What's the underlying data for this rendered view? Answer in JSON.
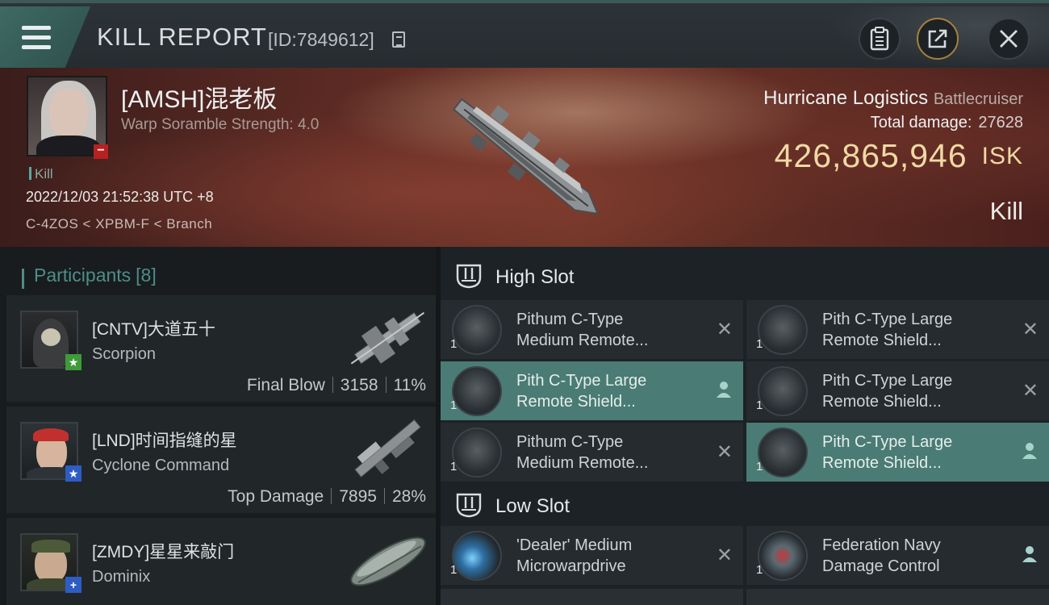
{
  "header": {
    "title": "KILL REPORT",
    "kill_id": "[ID:7849612]"
  },
  "victim": {
    "name": "[AMSH]混老板",
    "warp": "Warp Soramble Strength: 4.0",
    "tag": "Kill",
    "datetime": "2022/12/03 21:52:38 UTC +8",
    "location": "C-4ZOS < XPBM-F < Branch",
    "ship": "Hurricane Logistics",
    "ship_class": "Battlecruiser",
    "total_damage_label": "Total damage:",
    "total_damage": "27628",
    "isk_value": "426,865,946",
    "isk_unit": "ISK",
    "result": "Kill"
  },
  "participants": {
    "label": "Participants",
    "count": "[8]",
    "items": [
      {
        "name": "[CNTV]大道五十",
        "ship": "Scorpion",
        "role": "Final Blow",
        "damage": "3158",
        "percent": "11%",
        "badge": "★",
        "badge_color": "#3f9a3a"
      },
      {
        "name": "[LND]时间指缝的星",
        "ship": "Cyclone Command",
        "role": "Top Damage",
        "damage": "7895",
        "percent": "28%",
        "badge": "★",
        "badge_color": "#2e5cc2"
      },
      {
        "name": "[ZMDY]星星来敲门",
        "ship": "Dominix",
        "role": "",
        "damage": "",
        "percent": "",
        "badge": "+",
        "badge_color": "#2e5cc2"
      }
    ]
  },
  "slots": {
    "high_label": "High Slot",
    "low_label": "Low Slot",
    "high": [
      {
        "line1": "Pithum C-Type",
        "line2": "Medium Remote...",
        "qty": "1",
        "state": "destroyed"
      },
      {
        "line1": "Pith C-Type Large",
        "line2": "Remote Shield...",
        "qty": "1",
        "state": "destroyed"
      },
      {
        "line1": "Pith C-Type Large",
        "line2": "Remote Shield...",
        "qty": "1",
        "state": "dropped"
      },
      {
        "line1": "Pith C-Type Large",
        "line2": "Remote Shield...",
        "qty": "1",
        "state": "destroyed"
      },
      {
        "line1": "Pithum C-Type",
        "line2": "Medium Remote...",
        "qty": "1",
        "state": "destroyed"
      },
      {
        "line1": "Pith C-Type Large",
        "line2": "Remote Shield...",
        "qty": "1",
        "state": "dropped"
      }
    ],
    "low": [
      {
        "line1": "'Dealer' Medium",
        "line2": "Microwarpdrive",
        "qty": "1",
        "state": "destroyed"
      },
      {
        "line1": "Federation Navy",
        "line2": "Damage Control",
        "qty": "1",
        "state": "dropped"
      }
    ]
  }
}
